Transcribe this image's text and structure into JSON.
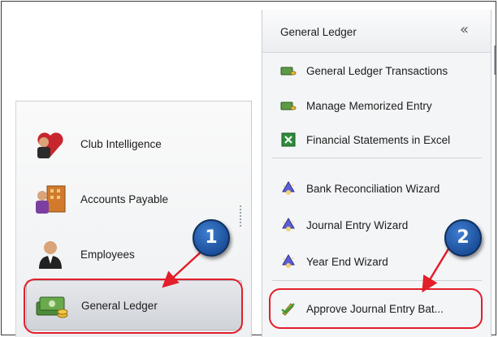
{
  "left_nav": {
    "items": [
      {
        "label": "Club Intelligence",
        "icon": "heart-person-icon"
      },
      {
        "label": "Accounts Payable",
        "icon": "building-person-icon"
      },
      {
        "label": "Employees",
        "icon": "employee-icon"
      },
      {
        "label": "General Ledger",
        "icon": "money-stack-icon"
      }
    ]
  },
  "right_menu": {
    "title": "General Ledger",
    "collapse_glyph": "«",
    "items": [
      {
        "label": "General Ledger Transactions",
        "icon": "money-icon"
      },
      {
        "label": "Manage Memorized Entry",
        "icon": "money-icon"
      },
      {
        "label": "Financial Statements in Excel",
        "icon": "excel-icon"
      },
      {
        "label": "Bank Reconciliation Wizard",
        "icon": "wizard-icon"
      },
      {
        "label": "Journal Entry Wizard",
        "icon": "wizard-icon"
      },
      {
        "label": "Year End Wizard",
        "icon": "wizard-icon"
      },
      {
        "label": "Approve Journal Entry Bat...",
        "icon": "approve-pencil-icon"
      }
    ]
  },
  "callouts": [
    {
      "number": "1",
      "color": "#e21f2a"
    },
    {
      "number": "2",
      "color": "#e21f2a"
    }
  ]
}
